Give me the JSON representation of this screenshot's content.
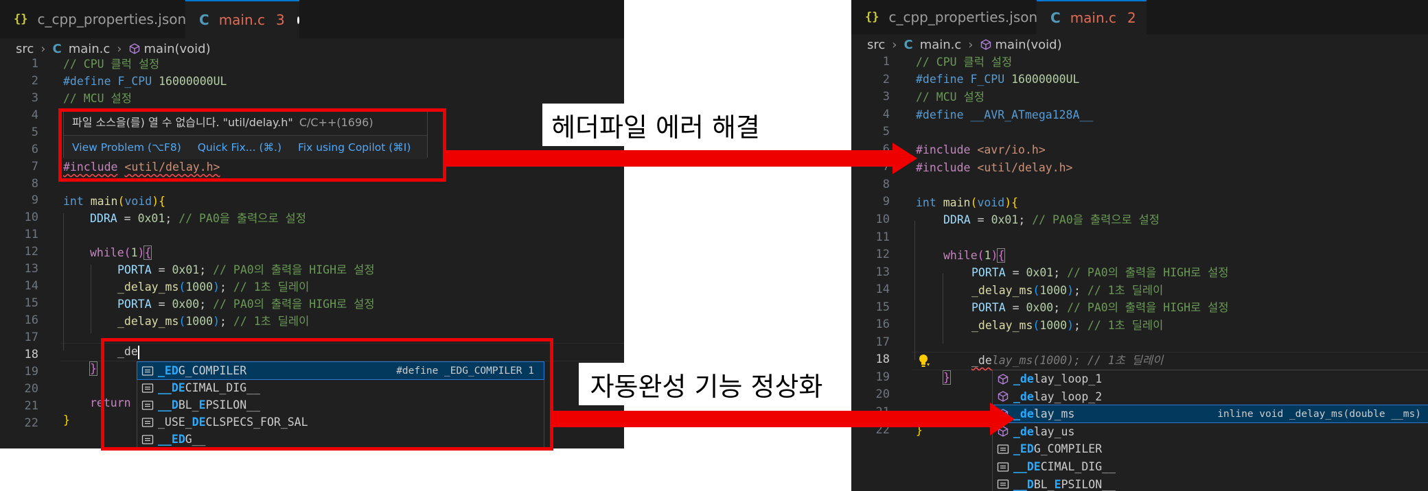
{
  "left": {
    "tabs": [
      {
        "icon": "{}",
        "label": "c_cpp_properties.json",
        "active": false
      },
      {
        "icon": "C",
        "label": "main.c",
        "active": true,
        "problems": "3"
      }
    ],
    "breadcrumb": {
      "folder": "src",
      "file_icon": "C",
      "file": "main.c",
      "symbol": "main(void)"
    },
    "line_numbers": [
      "1",
      "2",
      "3",
      "4",
      "5",
      "6",
      "7",
      "8",
      "9",
      "10",
      "11",
      "12",
      "13",
      "14",
      "15",
      "16",
      "17",
      "18",
      "19",
      "20",
      "21",
      "22"
    ],
    "code": {
      "l1": "// CPU 클럭 설정",
      "l2_kw": "#define",
      "l2_name": "F_CPU",
      "l2_val": "16000000UL",
      "l3": "// MCU 설정",
      "l7_kw": "#include",
      "l7_path": "<util/delay.h>",
      "l9_type": "int",
      "l9_fn": "main",
      "l9_open": "(",
      "l9_arg": "void",
      "l9_close": ")",
      "l9_brace": "{",
      "l10_var": "DDRA",
      "l10_eq": " = ",
      "l10_num": "0x01",
      "l10_semi": "; ",
      "l10_com": "// PA0을 출력으로 설정",
      "l12_kw": "while",
      "l12_open": "(",
      "l12_num": "1",
      "l12_close": ")",
      "l12_brace": "{",
      "l13_var": "PORTA",
      "l13_eq": " = ",
      "l13_num": "0x01",
      "l13_semi": "; ",
      "l13_com": "// PA0의 출력을 HIGH로 설정",
      "l14_fn": "_delay_ms",
      "l14_open": "(",
      "l14_num": "1000",
      "l14_close": ")",
      "l14_semi": "; ",
      "l14_com": "// 1초 딜레이",
      "l15_var": "PORTA",
      "l15_eq": " = ",
      "l15_num": "0x00",
      "l15_semi": "; ",
      "l15_com": "// PA0의 출력을 HIGH로 설정",
      "l16_fn": "_delay_ms",
      "l16_open": "(",
      "l16_num": "1000",
      "l16_close": ")",
      "l16_semi": "; ",
      "l16_com": "// 1초 딜레이",
      "l18_typed": "_de",
      "l19_brace": "}",
      "l21_kw": "return",
      "l22_brace": "}"
    },
    "hover": {
      "message": "파일 소스을(를) 열 수 없습니다. \"util/delay.h\"",
      "source": "C/C++(1696)",
      "actions": [
        "View Problem (⌥F8)",
        "Quick Fix... (⌘.)",
        "Fix using Copilot (⌘I)"
      ]
    },
    "suggestions": [
      {
        "icon": "constant-icon",
        "pre": "",
        "hl1": "_E",
        "mid": "",
        "hl2": "D",
        "post": "G_COMPILER",
        "detail": "#define _EDG_COMPILER 1"
      },
      {
        "icon": "constant-icon",
        "pre": "",
        "hl1": "__DE",
        "mid": "",
        "hl2": "",
        "post": "CIMAL_DIG__",
        "detail": ""
      },
      {
        "icon": "constant-icon",
        "pre": "",
        "hl1": "__D",
        "mid": "BL_",
        "hl2": "E",
        "post": "PSILON__",
        "detail": ""
      },
      {
        "icon": "constant-icon",
        "pre": "_USE_",
        "hl1": "DE",
        "mid": "",
        "hl2": "",
        "post": "CLSPECS_FOR_SAL",
        "detail": ""
      },
      {
        "icon": "constant-icon",
        "pre": "",
        "hl1": "__E",
        "mid": "",
        "hl2": "D",
        "post": "G__",
        "detail": ""
      }
    ]
  },
  "right": {
    "tabs": [
      {
        "icon": "{}",
        "label": "c_cpp_properties.json",
        "active": false
      },
      {
        "icon": "C",
        "label": "main.c",
        "active": true,
        "problems": "2"
      }
    ],
    "breadcrumb": {
      "folder": "src",
      "file_icon": "C",
      "file": "main.c",
      "symbol": "main(void)"
    },
    "line_numbers": [
      "1",
      "2",
      "3",
      "4",
      "5",
      "6",
      "7",
      "8",
      "9",
      "10",
      "11",
      "12",
      "13",
      "14",
      "15",
      "16",
      "17",
      "18",
      "19",
      "20",
      "21",
      "22"
    ],
    "code": {
      "l1": "// CPU 클럭 설정",
      "l2_kw": "#define",
      "l2_name": "F_CPU",
      "l2_val": "16000000UL",
      "l3": "// MCU 설정",
      "l4_kw": "#define",
      "l4_name": "__AVR_ATmega128A__",
      "l6_kw": "#include",
      "l6_path": "<avr/io.h>",
      "l7_kw": "#include",
      "l7_path": "<util/delay.h>",
      "l9_type": "int",
      "l9_fn": "main",
      "l9_open": "(",
      "l9_arg": "void",
      "l9_close": ")",
      "l9_brace": "{",
      "l10_var": "DDRA",
      "l10_eq": " = ",
      "l10_num": "0x01",
      "l10_semi": "; ",
      "l10_com": "// PA0을 출력으로 설정",
      "l12_kw": "while",
      "l12_open": "(",
      "l12_num": "1",
      "l12_close": ")",
      "l12_brace": "{",
      "l13_var": "PORTA",
      "l13_eq": " = ",
      "l13_num": "0x01",
      "l13_semi": "; ",
      "l13_com": "// PA0의 출력을 HIGH로 설정",
      "l14_fn": "_delay_ms",
      "l14_open": "(",
      "l14_num": "1000",
      "l14_close": ")",
      "l14_semi": "; ",
      "l14_com": "// 1초 딜레이",
      "l15_var": "PORTA",
      "l15_eq": " = ",
      "l15_num": "0x00",
      "l15_semi": "; ",
      "l15_com": "// PA0의 출력을 HIGH로 설정",
      "l16_fn": "_delay_ms",
      "l16_open": "(",
      "l16_num": "1000",
      "l16_close": ")",
      "l16_semi": "; ",
      "l16_com": "// 1초 딜레이",
      "l18_typed": "_de",
      "l18_ghost": "lay_ms(1000); // 1초 딜레이",
      "l19_brace": "}",
      "l22_brace": "}"
    },
    "suggestions": [
      {
        "icon": "method-icon",
        "pre": "",
        "hl1": "_de",
        "mid": "",
        "hl2": "",
        "post": "lay_loop_1",
        "detail": ""
      },
      {
        "icon": "method-icon",
        "pre": "",
        "hl1": "_de",
        "mid": "",
        "hl2": "",
        "post": "lay_loop_2",
        "detail": ""
      },
      {
        "icon": "method-icon",
        "pre": "",
        "hl1": "_de",
        "mid": "",
        "hl2": "",
        "post": "lay_ms",
        "detail": "inline void _delay_ms(double __ms)"
      },
      {
        "icon": "method-icon",
        "pre": "",
        "hl1": "_de",
        "mid": "",
        "hl2": "",
        "post": "lay_us",
        "detail": ""
      },
      {
        "icon": "constant-icon",
        "pre": "",
        "hl1": "_E",
        "mid": "",
        "hl2": "D",
        "post": "G_COMPILER",
        "detail": ""
      },
      {
        "icon": "constant-icon",
        "pre": "",
        "hl1": "__DE",
        "mid": "",
        "hl2": "",
        "post": "CIMAL_DIG__",
        "detail": ""
      },
      {
        "icon": "constant-icon",
        "pre": "",
        "hl1": "__D",
        "mid": "BL_",
        "hl2": "E",
        "post": "PSILON__",
        "detail": ""
      }
    ]
  },
  "annotations": {
    "top": "헤더파일 에러 해결",
    "bottom": "자동완성 기능 정상화"
  },
  "colors": {
    "highlight_red": "#ee0000",
    "editor_bg": "#1f1f1f",
    "selection_bg": "#04395e",
    "match_blue": "#2aaaff"
  }
}
